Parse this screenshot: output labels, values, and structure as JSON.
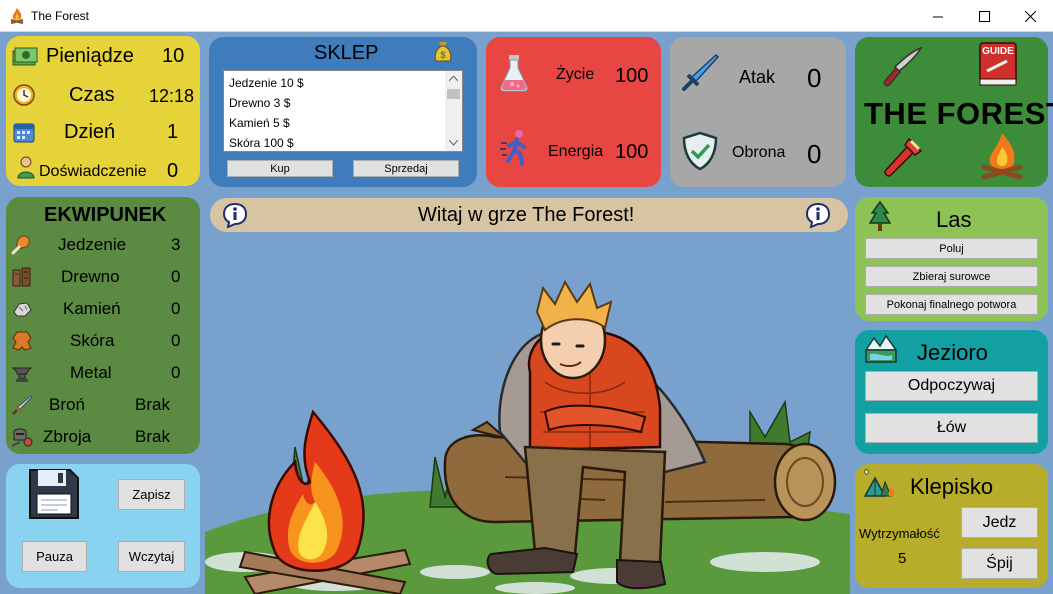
{
  "window": {
    "title": "The Forest",
    "icon": "campfire-icon",
    "controls": [
      "minimize-icon",
      "maximize-icon",
      "close-icon"
    ]
  },
  "stats": {
    "money_label": "Pieniądze",
    "money_value": "10",
    "time_label": "Czas",
    "time_value": "12:18",
    "day_label": "Dzień",
    "day_value": "1",
    "xp_label": "Doświadczenie",
    "xp_value": "0"
  },
  "shop": {
    "title": "SKLEP",
    "items": [
      "Jedzenie 10 $",
      "Drewno 3 $",
      "Kamień 5 $",
      "Skóra 100 $"
    ],
    "buy_label": "Kup",
    "sell_label": "Sprzedaj"
  },
  "vitals": {
    "life_label": "Życie",
    "life_value": "100",
    "energy_label": "Energia",
    "energy_value": "100"
  },
  "combat": {
    "attack_label": "Atak",
    "attack_value": "0",
    "defense_label": "Obrona",
    "defense_value": "0"
  },
  "logo": {
    "text": "THE FOREST",
    "guide_text": "GUIDE"
  },
  "inventory": {
    "title": "EKWIPUNEK",
    "items": [
      {
        "label": "Jedzenie",
        "value": "3",
        "icon": "food-icon"
      },
      {
        "label": "Drewno",
        "value": "0",
        "icon": "wood-icon"
      },
      {
        "label": "Kamień",
        "value": "0",
        "icon": "stone-icon"
      },
      {
        "label": "Skóra",
        "value": "0",
        "icon": "leather-icon"
      },
      {
        "label": "Metal",
        "value": "0",
        "icon": "metal-icon"
      },
      {
        "label": "Broń",
        "value": "Brak",
        "icon": "weapon-icon"
      },
      {
        "label": "Zbroja",
        "value": "Brak",
        "icon": "armor-icon"
      }
    ]
  },
  "system": {
    "save_label": "Zapisz",
    "pause_label": "Pauza",
    "load_label": "Wczytaj"
  },
  "message": "Witaj w grze The Forest!",
  "forest": {
    "title": "Las",
    "hunt_label": "Poluj",
    "gather_label": "Zbieraj surowce",
    "boss_label": "Pokonaj finalnego potwora"
  },
  "lake": {
    "title": "Jezioro",
    "rest_label": "Odpoczywaj",
    "fish_label": "Łów"
  },
  "camp": {
    "title": "Klepisko",
    "stamina_label": "Wytrzymałość",
    "stamina_value": "5",
    "eat_label": "Jedz",
    "sleep_label": "Śpij"
  },
  "colors": {
    "background": "#78a2cd",
    "stats_panel": "#e6d33a",
    "shop_panel": "#3f7cbc",
    "vitals_panel": "#e84642",
    "combat_panel": "#a7a7a7",
    "logo_panel": "#3c8c3a",
    "inventory_panel": "#5b8a43",
    "system_panel": "#89d2f0",
    "forest_panel": "#8dc255",
    "lake_panel": "#13a0a3",
    "camp_panel": "#b8ad2a",
    "info_bar": "#d7c4a3"
  }
}
